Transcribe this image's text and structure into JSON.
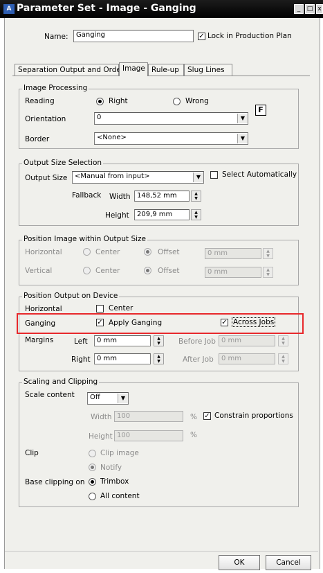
{
  "window": {
    "title": "Parameter Set - Image - Ganging",
    "app_icon_text": "A"
  },
  "name_row": {
    "label": "Name:",
    "value": "Ganging",
    "lock_label": "Lock in Production Plan"
  },
  "tabs": [
    {
      "label": "Separation Output and Order"
    },
    {
      "label": "Image"
    },
    {
      "label": "Rule-up"
    },
    {
      "label": "Slug Lines"
    }
  ],
  "image_processing": {
    "title": "Image Processing",
    "reading_label": "Reading",
    "right_label": "Right",
    "wrong_label": "Wrong",
    "orientation_label": "Orientation",
    "orientation_value": "0",
    "f_button": "F",
    "border_label": "Border",
    "border_value": "<None>"
  },
  "output_size": {
    "title": "Output Size Selection",
    "output_size_label": "Output Size",
    "output_size_value": "<Manual from input>",
    "select_auto_label": "Select Automatically",
    "fallback_label": "Fallback",
    "width_label": "Width",
    "width_value": "148,52 mm",
    "height_label": "Height",
    "height_value": "209,9 mm"
  },
  "position_image": {
    "title": "Position Image within Output Size",
    "horizontal_label": "Horizontal",
    "vertical_label": "Vertical",
    "center_label": "Center",
    "offset_label": "Offset",
    "h_offset_value": "0 mm",
    "v_offset_value": "0 mm"
  },
  "position_output": {
    "title": "Position Output on Device",
    "horizontal_label": "Horizontal",
    "center_label": "Center",
    "ganging_label": "Ganging",
    "apply_ganging_label": "Apply Ganging",
    "across_jobs_label": "Across Jobs",
    "margins_label": "Margins",
    "left_label": "Left",
    "left_value": "0 mm",
    "right_label": "Right",
    "right_value": "0 mm",
    "before_job_label": "Before Job",
    "before_job_value": "0 mm",
    "after_job_label": "After Job",
    "after_job_value": "0 mm"
  },
  "scaling": {
    "title": "Scaling and Clipping",
    "scale_label": "Scale content",
    "scale_value": "Off",
    "width_label": "Width",
    "width_value": "100",
    "height_label": "Height",
    "height_value": "100",
    "percent": "%",
    "constrain_label": "Constrain proportions",
    "clip_label": "Clip",
    "clip_image_label": "Clip image",
    "notify_label": "Notify",
    "base_label": "Base clipping on",
    "trimbox_label": "Trimbox",
    "all_content_label": "All content"
  },
  "footer": {
    "ok_label": "OK",
    "cancel_label": "Cancel"
  },
  "highlight_color": "#e8282b"
}
